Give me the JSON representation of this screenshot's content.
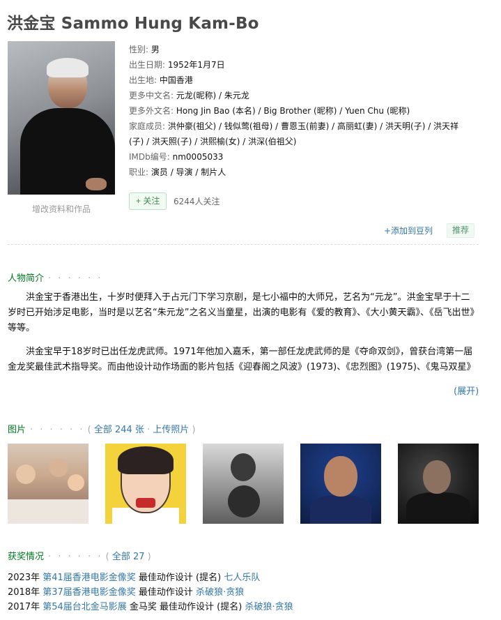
{
  "title": "洪金宝 Sammo Hung Kam-Bo",
  "photo_edit_label": "增改资料和作品",
  "info": {
    "gender_key": "性别:",
    "gender": "男",
    "birth_key": "出生日期:",
    "birth": "1952年1月7日",
    "birthplace_key": "出生地:",
    "birthplace": "中国香港",
    "cn_names_key": "更多中文名:",
    "cn_names": "元龙(昵称) / 朱元龙",
    "foreign_names_key": "更多外文名:",
    "foreign_names": "Hong Jin Bao (本名) / Big Brother (昵称) / Yuen Chu (昵称)",
    "family_key": "家庭成员:",
    "family_line1": "洪仲豪(祖父) / 钱似莺(祖母) / 曹恩玉(前妻) / 高丽虹(妻) / 洪天明(子) / 洪天祥",
    "family_line2": "(子) / 洪天照(子) / 洪熙榆(女) / 洪深(伯祖父)",
    "imdb_key": "IMDb编号:",
    "imdb": "nm0005033",
    "job_key": "职业:",
    "job": "演员 / 导演 / 制片人"
  },
  "follow": {
    "button": "+ 关注",
    "count": "6244人关注"
  },
  "actions": {
    "add_doulist": "+添加到豆列",
    "recommend": "推荐"
  },
  "bio": {
    "heading": "人物简介",
    "dots": "· · · · · ·",
    "p1": "洪金宝于香港出生，十岁时便拜入于占元门下学习京剧，是七小福中的大师兄，艺名为“元龙”。洪金宝早于十二岁时已开始涉足电影，当时是以艺名“朱元龙”之名义当童星，出演的电影有《爱的教育》、《大小黄天霸》、《岳飞出世》等等。",
    "p2": "洪金宝早于18岁时已出任龙虎武师。1971年他加入嘉禾，第一部任龙虎武师的是《夺命双剑》，曾获台湾第一届金龙奖最佳武术指导奖。而由他设计动作场面的影片包括《迎春阁之风波》(1973)、《忠烈图》(1975)、《鬼马双星》",
    "expand": "(展开)"
  },
  "photos": {
    "heading": "图片",
    "dots": "· · · · · ·",
    "open": "(",
    "all": "全部 244 张",
    "sep": "·",
    "upload": "上传照片",
    "close": ")"
  },
  "awards": {
    "heading": "获奖情况",
    "dots": "· · · · · ·",
    "open": "(",
    "all": "全部 27",
    "close": ")",
    "items": [
      {
        "year": "2023年",
        "festival": "第41届香港电影金像奖",
        "category": "最佳动作设计 (提名)",
        "work": "七人乐队"
      },
      {
        "year": "2018年",
        "festival": "第37届香港电影金像奖",
        "category": "最佳动作设计",
        "work": "杀破狼·贪狼"
      },
      {
        "year": "2017年",
        "festival": "第54届台北金马影展",
        "category": "金马奖 最佳动作设计 (提名)",
        "work": "杀破狼·贪狼"
      }
    ]
  }
}
